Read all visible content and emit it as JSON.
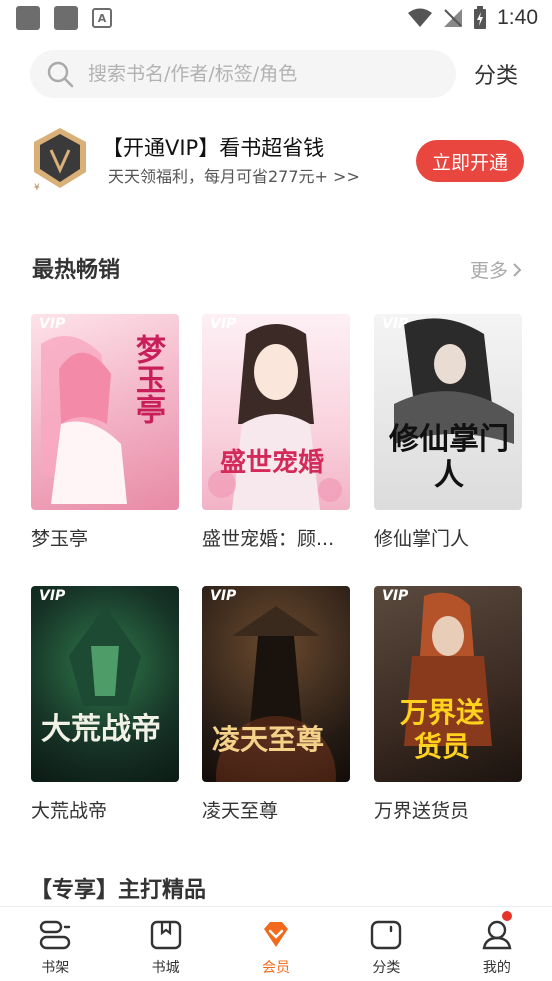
{
  "status_bar": {
    "time": "1:40",
    "app_badge": "A"
  },
  "search": {
    "placeholder": "搜索书名/作者/标签/角色"
  },
  "header": {
    "category_label": "分类"
  },
  "vip_banner": {
    "title": "【开通VIP】看书超省钱",
    "subtitle": "天天领福利，每月可省277元+ >>",
    "button_label": "立即开通",
    "badge_letter": "V"
  },
  "hot_section": {
    "title": "最热畅销",
    "more_label": "更多",
    "books": [
      {
        "title": "梦玉亭",
        "cover_text": "梦玉亭",
        "vip_tag": "VIP",
        "cover_color": "#f4c6d2"
      },
      {
        "title": "盛世宠婚：顾...",
        "cover_text": "盛世宠婚",
        "vip_tag": "VIP",
        "cover_color": "#f6dbe4"
      },
      {
        "title": "修仙掌门人",
        "cover_text": "修仙掌门人",
        "vip_tag": "VIP",
        "cover_color": "#e6e6e6"
      },
      {
        "title": "大荒战帝",
        "cover_text": "大荒战帝",
        "vip_tag": "VIP",
        "cover_color": "#163226"
      },
      {
        "title": "凌天至尊",
        "cover_text": "凌天至尊",
        "vip_tag": "VIP",
        "cover_color": "#241a14"
      },
      {
        "title": "万界送货员",
        "cover_text": "万界送货员",
        "vip_tag": "VIP",
        "cover_color": "#3a2a22"
      }
    ]
  },
  "next_section": {
    "title": "【专享】主打精品"
  },
  "bottom_nav": {
    "items": [
      {
        "label": "书架"
      },
      {
        "label": "书城"
      },
      {
        "label": "会员"
      },
      {
        "label": "分类"
      },
      {
        "label": "我的"
      }
    ],
    "active_color": "#f26b1d"
  }
}
